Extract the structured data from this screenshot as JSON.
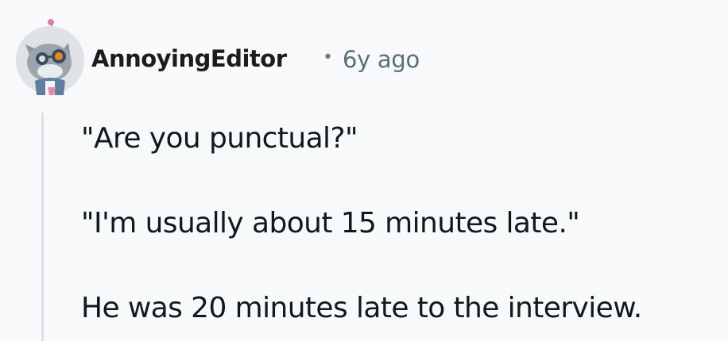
{
  "comment": {
    "author": "AnnoyingEditor",
    "separator": "•",
    "age": "6y ago",
    "avatar_icon": "cat-avatar-icon",
    "paragraphs": [
      "\"Are you punctual?\"",
      "\"I'm usually about 15 minutes late.\"",
      "He was 20 minutes late to the interview."
    ]
  },
  "colors": {
    "background": "#f8f9fa",
    "text": "#0f1a1c",
    "meta": "#576f76",
    "thread_line": "#dcdfe3"
  }
}
